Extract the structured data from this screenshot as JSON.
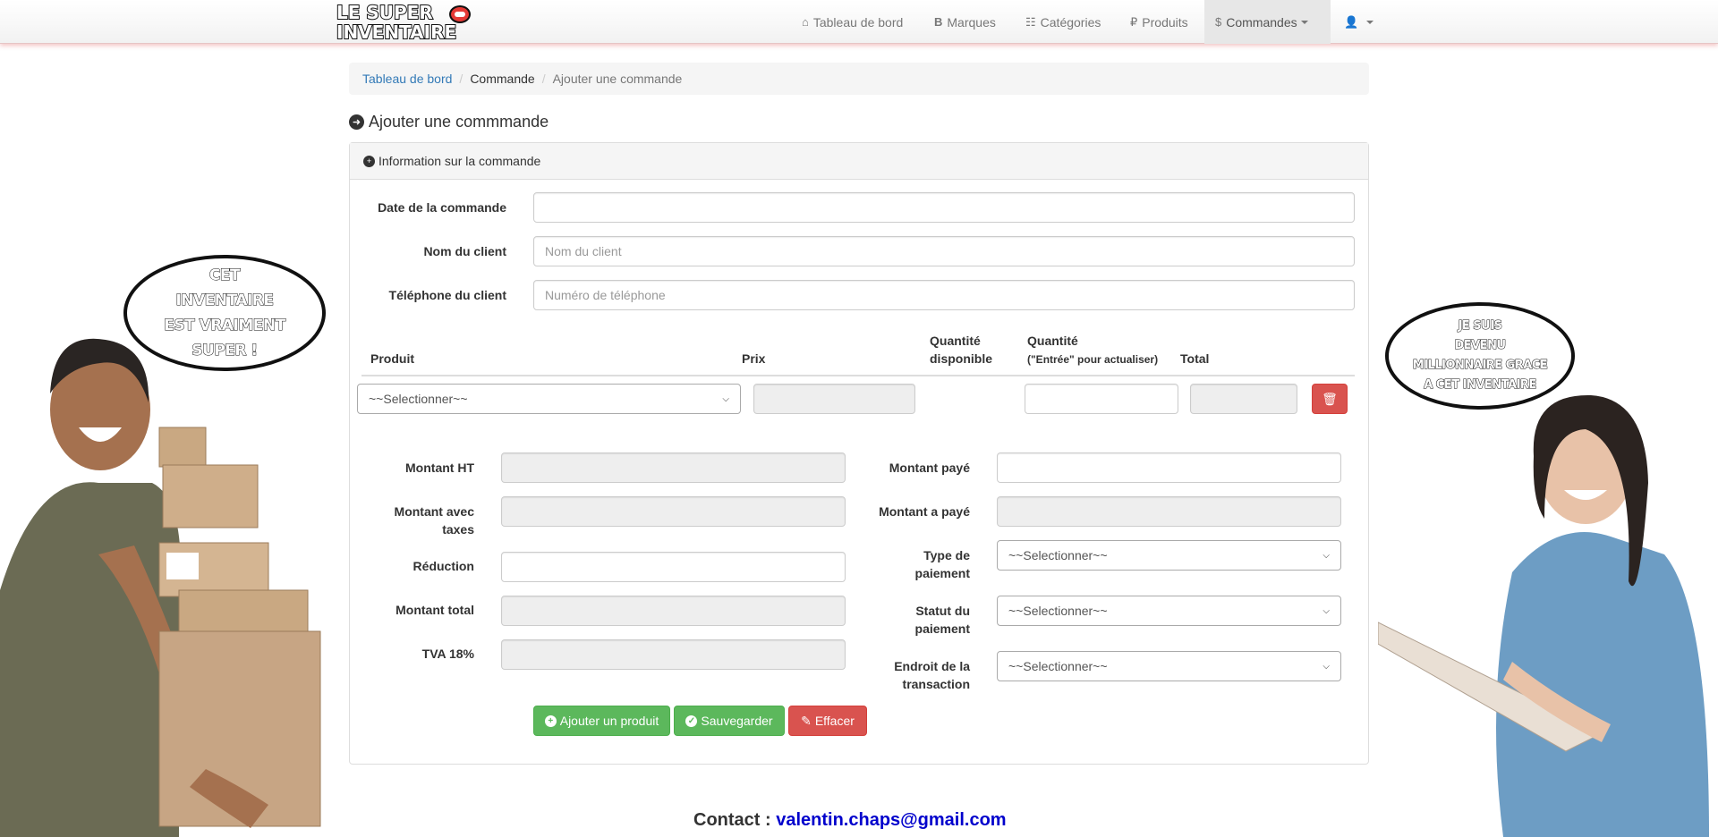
{
  "brand": {
    "line1": "LE SUPER",
    "line2": "INVENTAIRE"
  },
  "nav": {
    "items": [
      {
        "icon": "home-icon",
        "label": "Tableau de bord"
      },
      {
        "icon": "bold-icon",
        "label": "Marques"
      },
      {
        "icon": "list-icon",
        "label": "Catégories"
      },
      {
        "icon": "ruble-icon",
        "label": "Produits"
      },
      {
        "icon": "dollar-icon",
        "label": "Commandes"
      }
    ]
  },
  "breadcrumb": {
    "home": "Tableau de bord",
    "section": "Commande",
    "current": "Ajouter une commande"
  },
  "page_title": "Ajouter une commmande",
  "panel_title": "Information sur la commande",
  "form": {
    "date_label": "Date de la commande",
    "client_label": "Nom du client",
    "client_placeholder": "Nom du client",
    "phone_label": "Téléphone du client",
    "phone_placeholder": "Numéro de téléphone"
  },
  "table": {
    "col_product": "Produit",
    "col_price": "Prix",
    "col_available_1": "Quantité",
    "col_available_2": "disponible",
    "col_qty_1": "Quantité",
    "col_qty_2": "(\"Entrée\" pour actualiser)",
    "col_total": "Total",
    "row_select": "~~Selectionner~~"
  },
  "summary": {
    "ht": "Montant HT",
    "with_tax_1": "Montant avec",
    "with_tax_2": "taxes",
    "discount": "Réduction",
    "total": "Montant total",
    "vat": "TVA 18%",
    "paid": "Montant payé",
    "to_pay": "Montant a payé",
    "pay_type_1": "Type de",
    "pay_type_2": "paiement",
    "pay_status_1": "Statut du",
    "pay_status_2": "paiement",
    "place_1": "Endroit de la",
    "place_2": "transaction",
    "select": "~~Selectionner~~"
  },
  "buttons": {
    "add_product": "Ajouter un produit",
    "save": "Sauvegarder",
    "clear": "Effacer"
  },
  "contact": {
    "label": "Contact :",
    "email": "valentin.chaps@gmail.com"
  },
  "bubbles": {
    "left": [
      "CET",
      "INVENTAIRE",
      "EST VRAIMENT",
      "SUPER !"
    ],
    "right": [
      "JE SUIS",
      "DEVENU",
      "MILLIONNAIRE GRACE",
      "A CET INVENTAIRE"
    ]
  },
  "colors": {
    "primary": "#337ab7",
    "success": "#5cb85c",
    "danger": "#d9534f",
    "email": "#0000cc"
  }
}
